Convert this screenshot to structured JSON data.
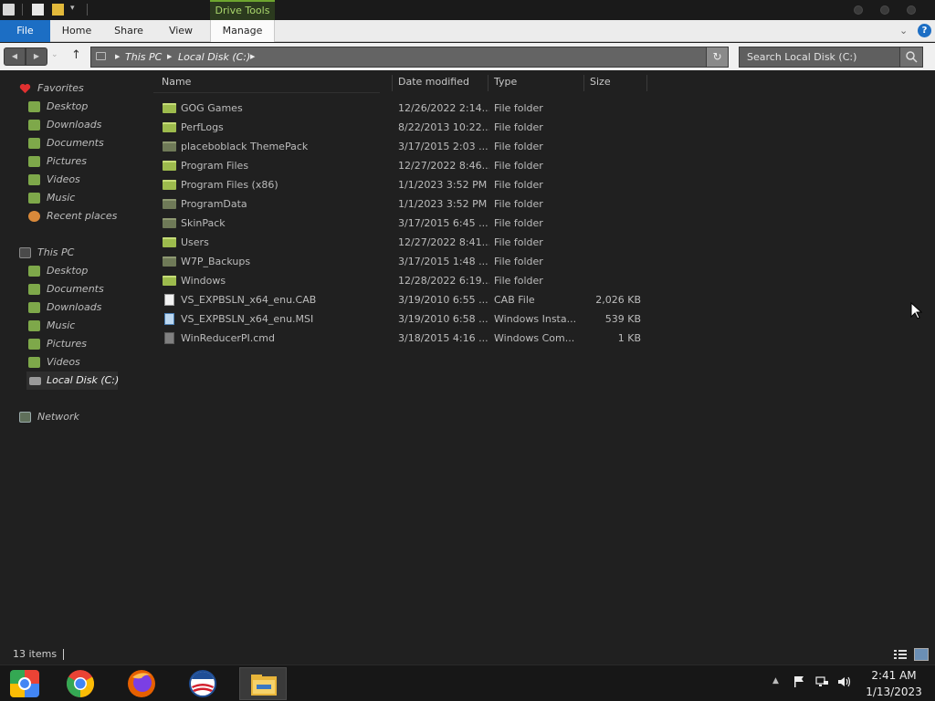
{
  "titlebar": {
    "contextual_tab": "Drive Tools"
  },
  "ribbon": {
    "tabs": [
      "File",
      "Home",
      "Share",
      "View",
      "Manage"
    ]
  },
  "address": {
    "crumbs": [
      "This PC",
      "Local Disk (C:)"
    ],
    "search_placeholder": "Search Local Disk (C:)"
  },
  "navpane": {
    "favorites_label": "Favorites",
    "favorites": [
      "Desktop",
      "Downloads",
      "Documents",
      "Pictures",
      "Videos",
      "Music",
      "Recent places"
    ],
    "thispc_label": "This PC",
    "thispc": [
      "Desktop",
      "Documents",
      "Downloads",
      "Music",
      "Pictures",
      "Videos",
      "Local Disk (C:)"
    ],
    "network_label": "Network"
  },
  "filelist": {
    "headers": {
      "name": "Name",
      "date": "Date modified",
      "type": "Type",
      "size": "Size"
    },
    "rows": [
      {
        "name": "GOG Games",
        "date": "12/26/2022 2:14...",
        "type": "File folder",
        "size": "",
        "icon": "folder-icon"
      },
      {
        "name": "PerfLogs",
        "date": "8/22/2013 10:22...",
        "type": "File folder",
        "size": "",
        "icon": "folder-icon"
      },
      {
        "name": "placeboblack ThemePack",
        "date": "3/17/2015 2:03 ...",
        "type": "File folder",
        "size": "",
        "icon": "folder-icon"
      },
      {
        "name": "Program Files",
        "date": "12/27/2022 8:46...",
        "type": "File folder",
        "size": "",
        "icon": "folder-icon"
      },
      {
        "name": "Program Files (x86)",
        "date": "1/1/2023 3:52 PM",
        "type": "File folder",
        "size": "",
        "icon": "folder-icon"
      },
      {
        "name": "ProgramData",
        "date": "1/1/2023 3:52 PM",
        "type": "File folder",
        "size": "",
        "icon": "folder-icon"
      },
      {
        "name": "SkinPack",
        "date": "3/17/2015 6:45 ...",
        "type": "File folder",
        "size": "",
        "icon": "folder-icon"
      },
      {
        "name": "Users",
        "date": "12/27/2022 8:41...",
        "type": "File folder",
        "size": "",
        "icon": "folder-icon"
      },
      {
        "name": "W7P_Backups",
        "date": "3/17/2015 1:48 ...",
        "type": "File folder",
        "size": "",
        "icon": "folder-icon"
      },
      {
        "name": "Windows",
        "date": "12/28/2022 6:19...",
        "type": "File folder",
        "size": "",
        "icon": "folder-icon"
      },
      {
        "name": "VS_EXPBSLN_x64_enu.CAB",
        "date": "3/19/2010 6:55 ...",
        "type": "CAB File",
        "size": "2,026 KB",
        "icon": "cab-file-icon"
      },
      {
        "name": "VS_EXPBSLN_x64_enu.MSI",
        "date": "3/19/2010 6:58 ...",
        "type": "Windows Insta...",
        "size": "539 KB",
        "icon": "msi-file-icon"
      },
      {
        "name": "WinReducerPI.cmd",
        "date": "3/18/2015 4:16 ...",
        "type": "Windows Com...",
        "size": "1 KB",
        "icon": "cmd-file-icon"
      }
    ]
  },
  "statusbar": {
    "item_count": "13 items"
  },
  "taskbar": {
    "apps": [
      "chrome-os-icon",
      "chrome-icon",
      "firefox-icon",
      "campaign-logo-icon",
      "file-explorer-icon"
    ],
    "time": "2:41 AM",
    "date": "1/13/2023"
  },
  "colors": {
    "background": "#202020",
    "file_tab": "#1c6ec4",
    "contextual_tab": "#6ea52f",
    "folder": "#9dbb4d"
  }
}
